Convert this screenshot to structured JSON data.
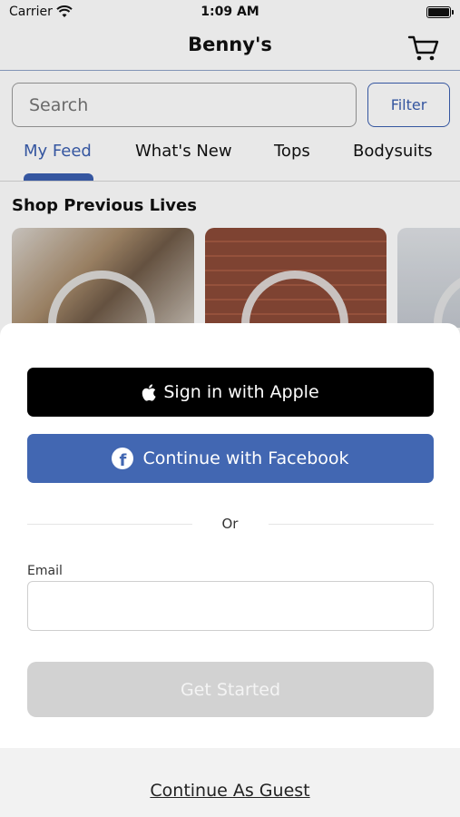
{
  "status_bar": {
    "carrier": "Carrier",
    "time": "1:09 AM",
    "wifi_icon": "wifi-icon",
    "battery_icon": "battery-icon"
  },
  "nav": {
    "title": "Benny's",
    "cart_icon": "cart-icon"
  },
  "search": {
    "placeholder": "Search",
    "value": "",
    "filter_label": "Filter"
  },
  "tabs": [
    {
      "label": "My Feed",
      "active": true
    },
    {
      "label": "What's New",
      "active": false
    },
    {
      "label": "Tops",
      "active": false
    },
    {
      "label": "Bodysuits",
      "active": false
    }
  ],
  "previous_lives": {
    "title": "Shop Previous Lives",
    "video_count_visible": 3
  },
  "sheet": {
    "apple_label": "Sign in with Apple",
    "facebook_label": "Continue with Facebook",
    "or_label": "Or",
    "email_label": "Email",
    "email_value": "",
    "email_placeholder": "",
    "get_started_label": "Get Started",
    "guest_label": "Continue As Guest"
  },
  "colors": {
    "accent": "#3b5fb0",
    "facebook": "#4267b2",
    "apple": "#000000",
    "disabled": "#d2d2d2"
  }
}
